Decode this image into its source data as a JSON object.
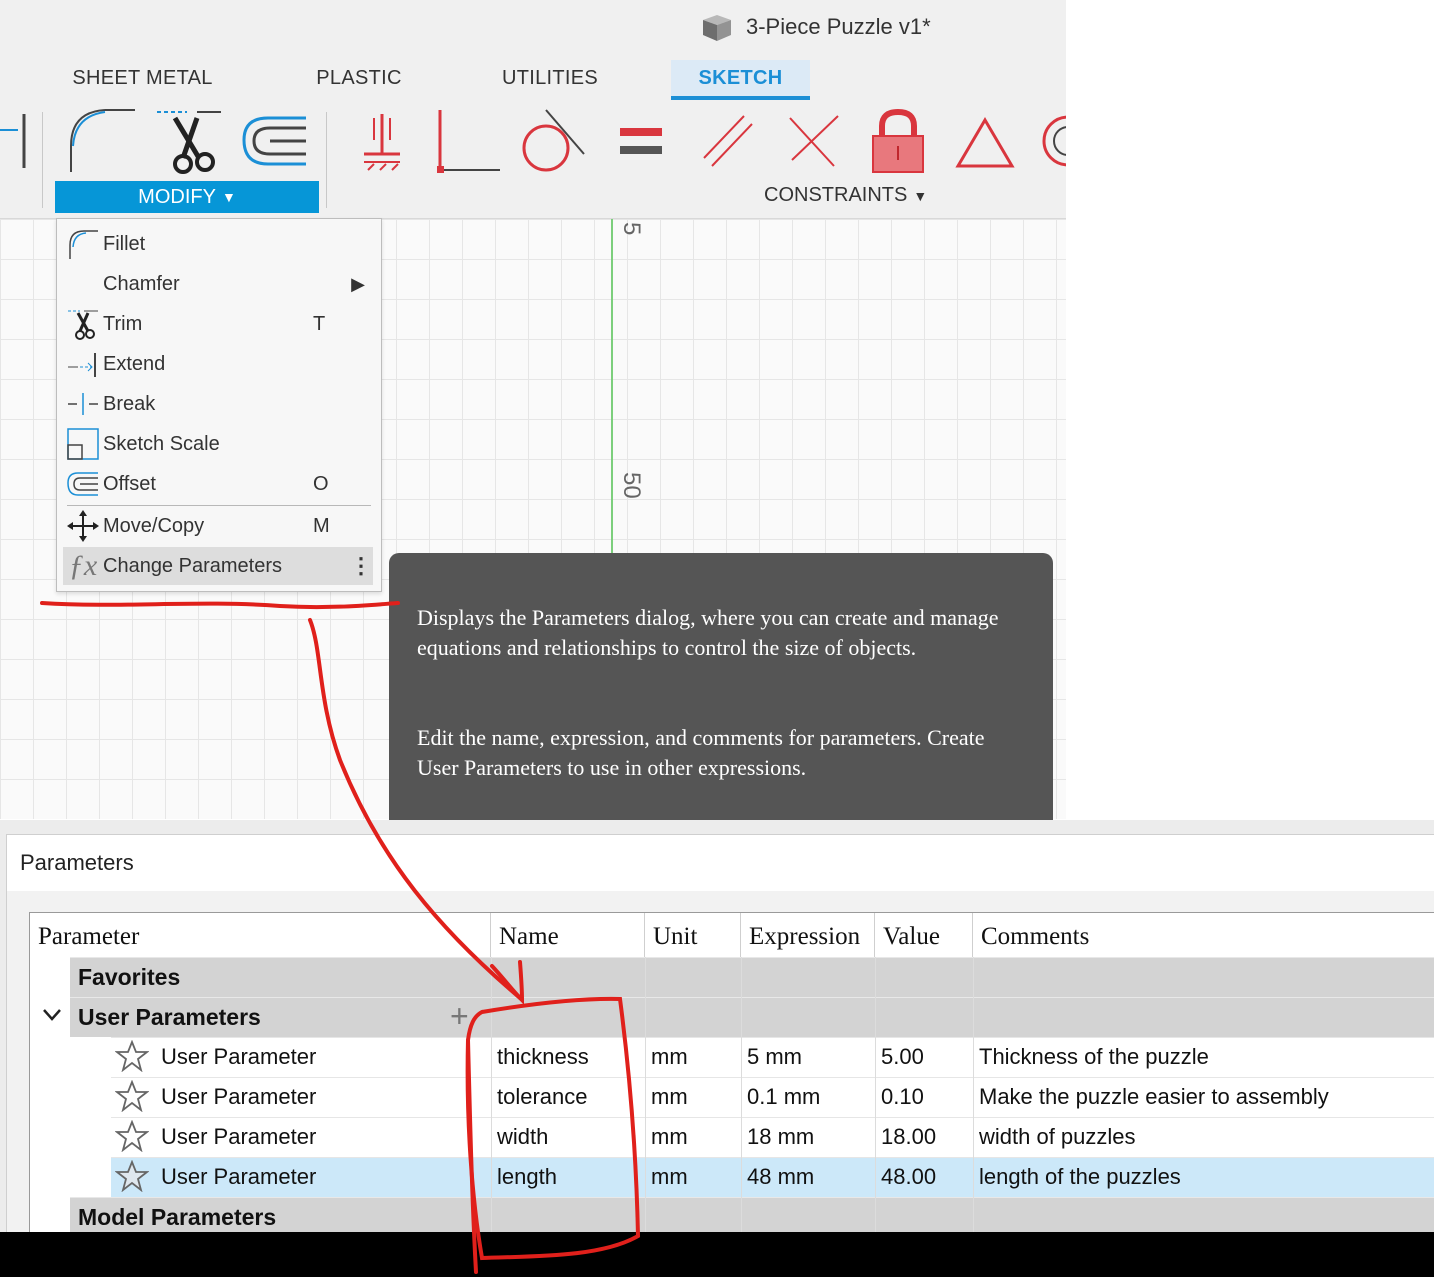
{
  "window": {
    "document_title": "3-Piece Puzzle v1*"
  },
  "ribbon": {
    "tabs": [
      {
        "label": "SHEET METAL"
      },
      {
        "label": "PLASTIC"
      },
      {
        "label": "UTILITIES"
      },
      {
        "label": "SKETCH",
        "active": true
      }
    ],
    "modify_label": "MODIFY",
    "constraints_label": "CONSTRAINTS"
  },
  "canvas": {
    "axis_labels": [
      "5",
      "50"
    ],
    "axis_color": "#7ccf7c"
  },
  "modify_menu": {
    "items": [
      {
        "label": "Fillet",
        "icon": "fillet-icon",
        "shortcut": ""
      },
      {
        "label": "Chamfer",
        "icon": "",
        "shortcut": ""
      },
      {
        "label": "Trim",
        "icon": "scissors-icon",
        "shortcut": "T"
      },
      {
        "label": "Extend",
        "icon": "extend-icon",
        "shortcut": ""
      },
      {
        "label": "Break",
        "icon": "break-icon",
        "shortcut": ""
      },
      {
        "label": "Sketch Scale",
        "icon": "sketch-scale-icon",
        "shortcut": ""
      },
      {
        "label": "Offset",
        "icon": "offset-icon",
        "shortcut": "O"
      },
      {
        "label": "Move/Copy",
        "icon": "move-icon",
        "shortcut": "M"
      },
      {
        "label": "Change Parameters",
        "icon": "fx-icon",
        "shortcut": ""
      }
    ]
  },
  "tooltip": {
    "paragraph1": "Displays the Parameters dialog, where you can create and manage equations and relationships to control the size of objects.",
    "paragraph2": "Edit the name, expression, and comments for parameters. Create User Parameters to use in other expressions."
  },
  "parameters_dialog": {
    "title": "Parameters",
    "columns": [
      "Parameter",
      "Name",
      "Unit",
      "Expression",
      "Value",
      "Comments"
    ],
    "groups": {
      "favorites": "Favorites",
      "user": "User Parameters",
      "model": "Model Parameters"
    },
    "rows": [
      {
        "parameter": "User Parameter",
        "name": "thickness",
        "unit": "mm",
        "expression": "5 mm",
        "value": "5.00",
        "comments": "Thickness of the puzzle"
      },
      {
        "parameter": "User Parameter",
        "name": "tolerance",
        "unit": "mm",
        "expression": "0.1 mm",
        "value": "0.10",
        "comments": "Make the puzzle easier to assembly"
      },
      {
        "parameter": "User Parameter",
        "name": "width",
        "unit": "mm",
        "expression": "18 mm",
        "value": "18.00",
        "comments": "width of puzzles"
      },
      {
        "parameter": "User Parameter",
        "name": "length",
        "unit": "mm",
        "expression": "48 mm",
        "value": "48.00",
        "comments": "length of the puzzles"
      }
    ]
  },
  "colors": {
    "accent": "#0696d7",
    "constraint_red": "#d9363e",
    "annotation_red": "#e0201b",
    "selection": "#cce8f9"
  }
}
